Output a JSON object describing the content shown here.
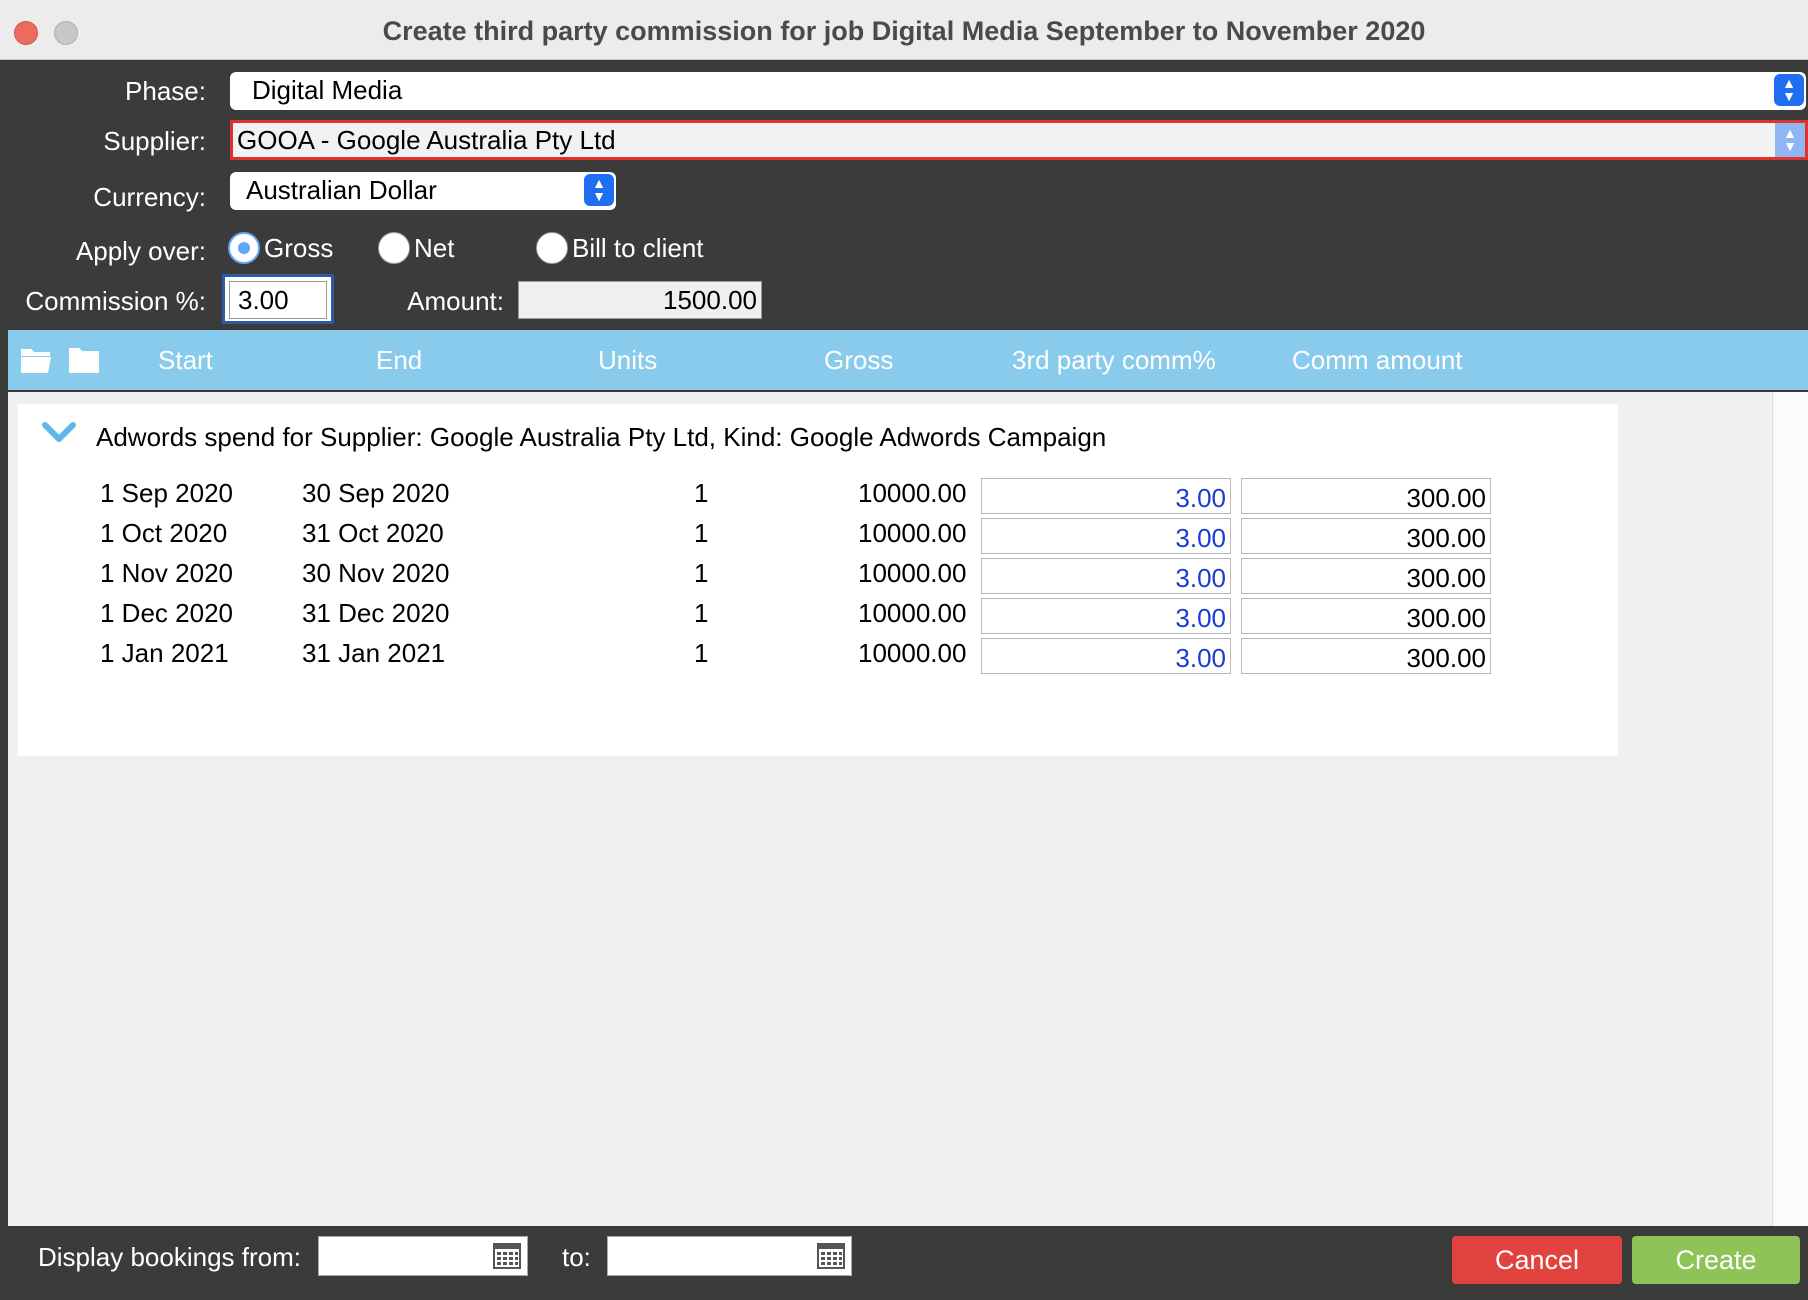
{
  "window": {
    "title": "Create third party commission for job Digital Media September to November 2020"
  },
  "form": {
    "phase_label": "Phase:",
    "phase_value": "Digital Media",
    "supplier_label": "Supplier:",
    "supplier_value": "GOOA - Google Australia Pty Ltd",
    "currency_label": "Currency:",
    "currency_value": "Australian Dollar",
    "apply_label": "Apply over:",
    "apply_options": [
      {
        "label": "Gross",
        "selected": true
      },
      {
        "label": "Net",
        "selected": false
      },
      {
        "label": "Bill to client",
        "selected": false
      }
    ],
    "commission_label": "Commission %:",
    "commission_value": "3.00",
    "amount_label": "Amount:",
    "amount_value": "1500.00"
  },
  "table": {
    "headers": [
      "Start",
      "End",
      "Units",
      "Gross",
      "3rd party comm%",
      "Comm amount"
    ],
    "group_title": "Adwords spend for Supplier: Google Australia Pty Ltd, Kind: Google Adwords Campaign",
    "rows": [
      {
        "start": "1 Sep 2020",
        "end": "30 Sep 2020",
        "units": "1",
        "gross": "10000.00",
        "comm_pct": "3.00",
        "comm_amount": "300.00"
      },
      {
        "start": "1 Oct 2020",
        "end": "31 Oct 2020",
        "units": "1",
        "gross": "10000.00",
        "comm_pct": "3.00",
        "comm_amount": "300.00"
      },
      {
        "start": "1 Nov 2020",
        "end": "30 Nov 2020",
        "units": "1",
        "gross": "10000.00",
        "comm_pct": "3.00",
        "comm_amount": "300.00"
      },
      {
        "start": "1 Dec 2020",
        "end": "31 Dec 2020",
        "units": "1",
        "gross": "10000.00",
        "comm_pct": "3.00",
        "comm_amount": "300.00"
      },
      {
        "start": "1 Jan 2021",
        "end": "31 Jan 2021",
        "units": "1",
        "gross": "10000.00",
        "comm_pct": "3.00",
        "comm_amount": "300.00"
      }
    ]
  },
  "footer": {
    "from_label": "Display bookings from:",
    "to_label": "to:",
    "cancel_label": "Cancel",
    "create_label": "Create"
  },
  "icons": {
    "window_close": "close-icon",
    "window_minimize": "minimize-icon",
    "open_folder": "folder-open-icon",
    "closed_folder": "folder-icon",
    "group_toggle": "chevron-down-icon",
    "calendar": "calendar-icon",
    "select_stepper": "stepper-icon"
  },
  "colors": {
    "header_bar": "#89cbec",
    "invalid_border": "#e0312c",
    "cancel_button": "#e2433f",
    "create_button": "#8dc357",
    "editable_value": "#1a3bd4"
  }
}
